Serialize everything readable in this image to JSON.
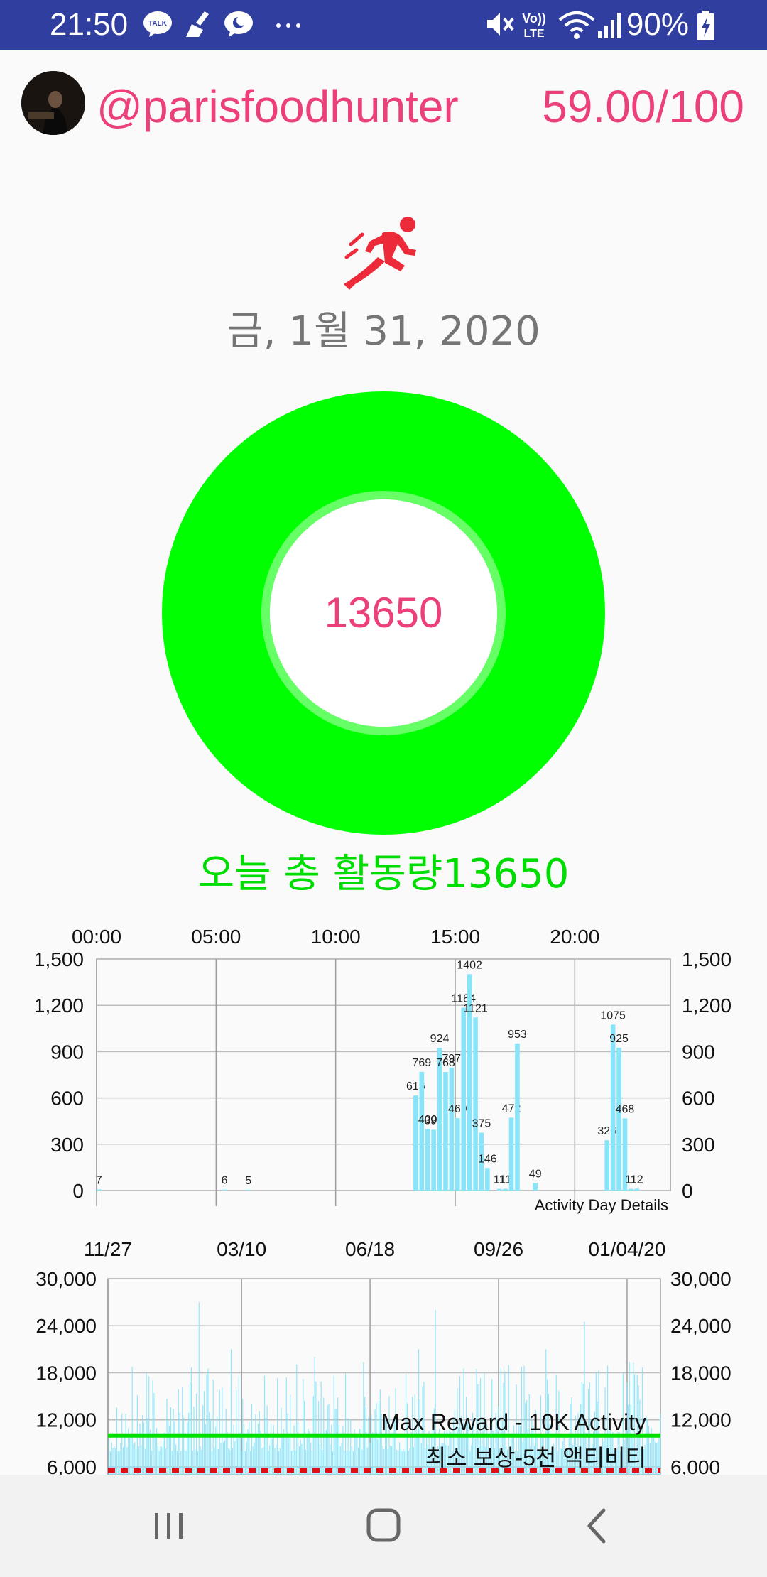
{
  "status_bar": {
    "time": "21:50",
    "battery": "90%",
    "left_icons": [
      "kakaotalk-icon",
      "broom-icon",
      "moon-chat-icon",
      "more-dots-icon"
    ],
    "right_icons": [
      "mute-icon",
      "volte-icon",
      "wifi-icon",
      "signal-icon",
      "battery-charging-icon"
    ],
    "volte_label": "Vo)) LTE"
  },
  "header": {
    "username": "@parisfoodhunter",
    "score": "59.00/100"
  },
  "date": "금, 1월 31, 2020",
  "ring": {
    "value": "13650",
    "progress_fraction": 1.0,
    "ring_color": "#00ff00",
    "inner_ring_color": "#66ff66",
    "value_color": "#ec407a"
  },
  "today_total": "오늘 총 활동량13650",
  "colors": {
    "accent_pink": "#ec407a",
    "status_bar": "#303f9f",
    "bar_fill": "#88e4f8",
    "max_reward_line": "#00e000",
    "min_reward_line": "#dd1111"
  },
  "chart_data": [
    {
      "type": "bar",
      "title": "",
      "description_label": "Activity Day Details",
      "x_tick_labels": [
        "00:00",
        "05:00",
        "10:00",
        "15:00",
        "20:00"
      ],
      "x_tick_hours": [
        0,
        5,
        10,
        15,
        20
      ],
      "x_range_hours": [
        0,
        24
      ],
      "y_ticks": [
        "1,500",
        "1,200",
        "900",
        "600",
        "300",
        "0"
      ],
      "y_tick_values": [
        1500,
        1200,
        900,
        600,
        300,
        0
      ],
      "ylim": [
        0,
        1500
      ],
      "grid": true,
      "axis_labels_both_sides": true,
      "points": [
        {
          "hour": 0.0,
          "value": 7,
          "label": "7"
        },
        {
          "hour": 5.25,
          "value": 6,
          "label": "6"
        },
        {
          "hour": 6.25,
          "value": 5,
          "label": "5"
        },
        {
          "hour": 13.25,
          "value": 616,
          "label": "616"
        },
        {
          "hour": 13.5,
          "value": 769,
          "label": "769"
        },
        {
          "hour": 13.75,
          "value": 400,
          "label": "400"
        },
        {
          "hour": 14.0,
          "value": 394,
          "label": "394"
        },
        {
          "hour": 14.25,
          "value": 924,
          "label": "924"
        },
        {
          "hour": 14.5,
          "value": 768,
          "label": "768"
        },
        {
          "hour": 14.75,
          "value": 797,
          "label": "797"
        },
        {
          "hour": 15.0,
          "value": 469,
          "label": "469"
        },
        {
          "hour": 15.25,
          "value": 1184,
          "label": "1184"
        },
        {
          "hour": 15.5,
          "value": 1402,
          "label": "1402"
        },
        {
          "hour": 15.75,
          "value": 1121,
          "label": "1121"
        },
        {
          "hour": 16.0,
          "value": 375,
          "label": "375"
        },
        {
          "hour": 16.25,
          "value": 146,
          "label": "146"
        },
        {
          "hour": 16.75,
          "value": 11,
          "label": "11"
        },
        {
          "hour": 17.0,
          "value": 11,
          "label": "11"
        },
        {
          "hour": 17.25,
          "value": 472,
          "label": "472"
        },
        {
          "hour": 17.5,
          "value": 953,
          "label": "953"
        },
        {
          "hour": 18.25,
          "value": 49,
          "label": "49"
        },
        {
          "hour": 21.25,
          "value": 326,
          "label": "326"
        },
        {
          "hour": 21.5,
          "value": 1075,
          "label": "1075"
        },
        {
          "hour": 21.75,
          "value": 925,
          "label": "925"
        },
        {
          "hour": 22.0,
          "value": 468,
          "label": "468"
        },
        {
          "hour": 22.25,
          "value": 11,
          "label": "11"
        },
        {
          "hour": 22.5,
          "value": 12,
          "label": "12"
        }
      ]
    },
    {
      "type": "bar",
      "title": "",
      "x_tick_labels": [
        "11/27",
        "03/10",
        "06/18",
        "09/26",
        "01/04/20"
      ],
      "x_tick_days": [
        0,
        104,
        204,
        304,
        404
      ],
      "x_range_days": [
        0,
        430
      ],
      "y_ticks": [
        "30,000",
        "24,000",
        "18,000",
        "12,000",
        "6,000"
      ],
      "y_tick_values": [
        30000,
        24000,
        18000,
        12000,
        6000
      ],
      "ylim": [
        5000,
        30000
      ],
      "grid": true,
      "axis_labels_both_sides": true,
      "limit_lines": [
        {
          "name": "Max Reward - 10K Activity",
          "value": 10000,
          "color": "#00e000",
          "style": "solid"
        },
        {
          "name": "최소 보상-5천 액티비티",
          "value": 5000,
          "color": "#dd1111",
          "style": "dashed"
        }
      ],
      "daily_value_range": [
        8000,
        27000
      ],
      "notable_peaks": [
        {
          "day": 70,
          "value": 27000
        },
        {
          "day": 95,
          "value": 21000
        },
        {
          "day": 160,
          "value": 20000
        },
        {
          "day": 241,
          "value": 21000
        },
        {
          "day": 254,
          "value": 26000
        },
        {
          "day": 340,
          "value": 21000
        },
        {
          "day": 370,
          "value": 24500
        }
      ]
    }
  ],
  "nav_bar": {
    "buttons": [
      "recent-apps-icon",
      "home-icon",
      "back-icon"
    ]
  }
}
